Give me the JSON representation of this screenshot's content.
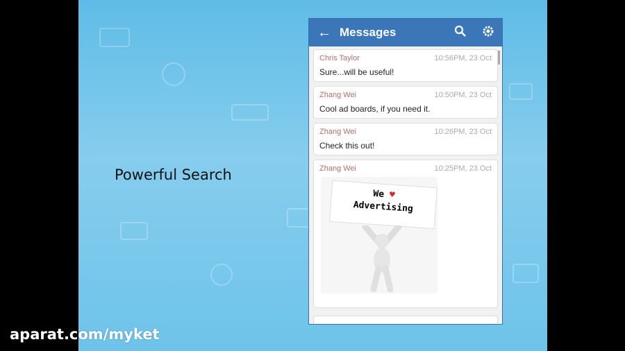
{
  "caption": "Powerful Search",
  "watermark": "aparat.com/myket",
  "app": {
    "title": "Messages",
    "back_icon": "arrow-left-icon",
    "search_icon": "search-icon",
    "settings_icon": "gear-icon"
  },
  "messages": [
    {
      "sender": "Chris Taylor",
      "time": "10:56PM, 23 Oct",
      "text": "Sure...will be useful!"
    },
    {
      "sender": "Zhang Wei",
      "time": "10:50PM, 23 Oct",
      "text": "Cool ad boards, if you need it."
    },
    {
      "sender": "Zhang Wei",
      "time": "10:26PM, 23 Oct",
      "text": "Check this out!"
    },
    {
      "sender": "Zhang Wei",
      "time": "10:25PM, 23 Oct",
      "image_text_line1": "We",
      "image_text_line2": "Advertising"
    }
  ],
  "colors": {
    "appbar": "#3b76b8",
    "sender": "#b26e6e",
    "background": "#6ec3ea"
  }
}
